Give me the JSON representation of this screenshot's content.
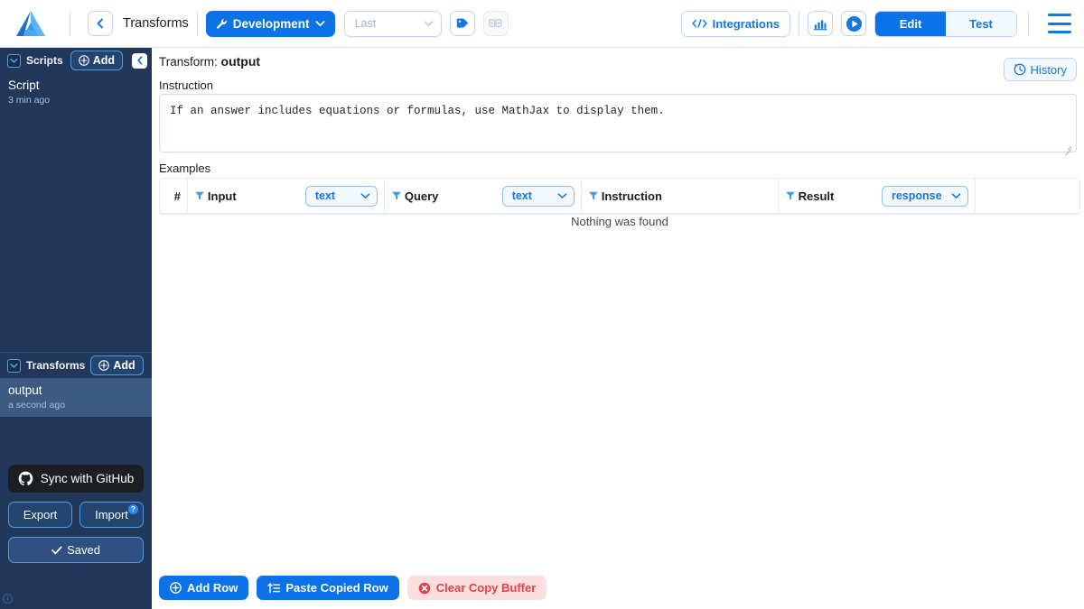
{
  "topbar": {
    "logo_icon": "app-logo-icon",
    "back_icon": "chevron-left-icon",
    "breadcrumb": "Transforms",
    "environment": {
      "label": "Development",
      "icon": "wrench-icon",
      "caret": "chevron-down-icon"
    },
    "version_select": {
      "placeholder": "Last",
      "value": "",
      "caret": "chevron-down-icon"
    },
    "add_tag_icon": "tag-plus-icon",
    "duplicate_icon": "copy-disabled-icon",
    "integrations": {
      "label": "Integrations",
      "icon": "code-brackets-icon"
    },
    "analytics_icon": "bar-chart-icon",
    "run_icon": "play-circle-icon",
    "mode_tabs": [
      {
        "label": "Edit",
        "active": true
      },
      {
        "label": "Test",
        "active": false
      }
    ],
    "menu_icon": "hamburger-menu-icon"
  },
  "sidebar": {
    "scripts_panel": {
      "title": "Scripts",
      "collapse_icon": "chevron-down-box-icon",
      "add_label": "Add",
      "add_icon": "plus-circle-icon",
      "hide_sidebar_icon": "chevron-left-icon",
      "items": [
        {
          "name": "Script",
          "time": "3 min ago",
          "selected": false
        }
      ]
    },
    "transforms_panel": {
      "title": "Transforms",
      "collapse_icon": "chevron-down-box-icon",
      "add_label": "Add",
      "add_icon": "plus-circle-icon",
      "items": [
        {
          "name": "output",
          "time": "a second ago",
          "selected": true
        }
      ]
    },
    "footer": {
      "github_label": "Sync with GitHub",
      "github_icon": "github-icon",
      "export_label": "Export",
      "import_label": "Import",
      "import_badge": "?",
      "saved_label": "Saved",
      "saved_icon": "check-icon",
      "info_icon": "info-circle-icon"
    }
  },
  "main": {
    "transform_prefix": "Transform:",
    "transform_name": "output",
    "history": {
      "label": "History",
      "icon": "clock-history-icon"
    },
    "instruction_label": "Instruction",
    "instruction_value": "If an answer includes equations or formulas, use MathJax to display them.",
    "examples_label": "Examples",
    "table": {
      "columns": [
        {
          "header": "#",
          "filterable": false,
          "type_select": null
        },
        {
          "header": "Input",
          "filterable": true,
          "filter_icon": "filter-icon",
          "type_select": "text"
        },
        {
          "header": "Query",
          "filterable": true,
          "filter_icon": "filter-icon",
          "type_select": "text"
        },
        {
          "header": "Instruction",
          "filterable": true,
          "filter_icon": "filter-icon",
          "type_select": null
        },
        {
          "header": "Result",
          "filterable": true,
          "filter_icon": "filter-icon",
          "type_select": "response"
        },
        {
          "header": "",
          "filterable": false,
          "type_select": null
        }
      ],
      "rows": [],
      "empty_message": "Nothing was found"
    },
    "actions": [
      {
        "label": "Add Row",
        "icon": "plus-circle-icon",
        "style": "primary"
      },
      {
        "label": "Paste Copied Row",
        "icon": "paste-icon",
        "style": "primary"
      },
      {
        "label": "Clear Copy Buffer",
        "icon": "x-circle-icon",
        "style": "danger"
      }
    ]
  },
  "colors": {
    "accent_blue": "#0b72e7",
    "link_blue": "#1478e0",
    "sidebar_bg": "#22385a",
    "sidebar_selected": "#3c5a82",
    "danger_red": "#e0424a",
    "danger_bg": "#fcdede"
  }
}
